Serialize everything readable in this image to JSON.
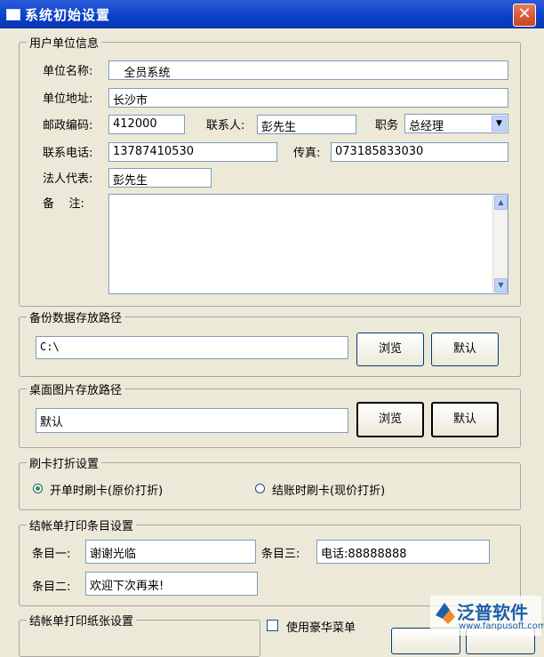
{
  "window": {
    "title": "系统初始设置",
    "close_glyph": "✕"
  },
  "user_info": {
    "legend": "用户单位信息",
    "name_label": "单位名称:",
    "name_value": "   全员系统",
    "address_label": "单位地址:",
    "address_value": "长沙市",
    "postcode_label": "邮政编码:",
    "postcode_value": "412000",
    "contact_label": "联系人:",
    "contact_value": "彭先生",
    "position_label": "职务",
    "position_value": "总经理",
    "phone_label": "联系电话:",
    "phone_value": "13787410530",
    "fax_label": "传真:",
    "fax_value": "073185833030",
    "legal_label": "法人代表:",
    "legal_value": "彭先生",
    "remark_label": "备    注:",
    "remark_value": ""
  },
  "backup": {
    "legend": "备份数据存放路径",
    "path": "C:\\",
    "browse": "浏览",
    "default": "默认"
  },
  "wallpaper": {
    "legend": "桌面图片存放路径",
    "path": "默认",
    "browse": "浏览",
    "default": "默认"
  },
  "card_discount": {
    "legend": "刷卡打折设置",
    "option_open": "开单时刷卡(原价打折)",
    "option_checkout": "结账时刷卡(现价打折)",
    "selected": "option_open"
  },
  "receipt_items": {
    "legend": "结帐单打印条目设置",
    "item1_label": "条目一:",
    "item1_value": "谢谢光临",
    "item2_label": "条目二:",
    "item2_value": "欢迎下次再来!",
    "item3_label": "条目三:",
    "item3_value": "电话:88888888"
  },
  "receipt_paper": {
    "legend": "结帐单打印纸张设置"
  },
  "luxury_menu": {
    "label": "使用豪华菜单",
    "checked": false
  },
  "watermark": {
    "brand": "泛普软件",
    "url": "www.fanpusoft.com"
  },
  "colors": {
    "title_bar": "#0a3fc8",
    "window_bg": "#ece9d8",
    "selected_radio": "#21a121",
    "brand_blue": "#1f5fa8"
  }
}
